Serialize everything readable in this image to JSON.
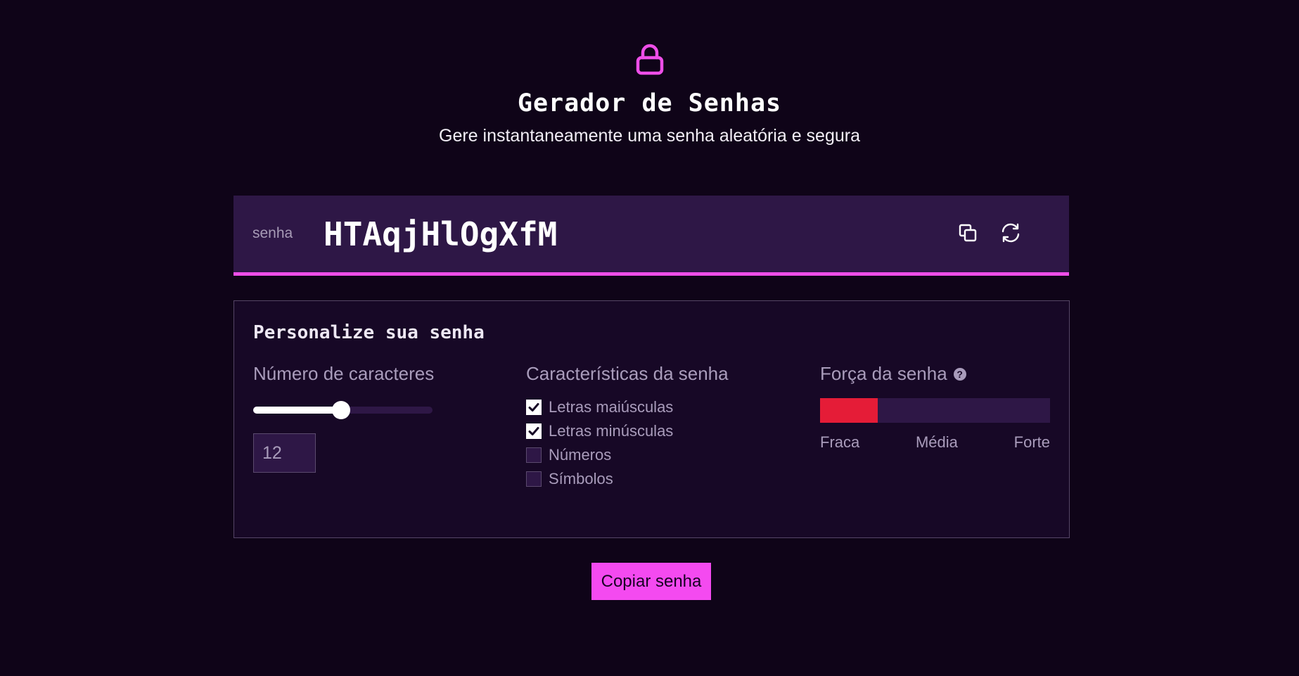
{
  "header": {
    "title": "Gerador de Senhas",
    "subtitle": "Gere instantaneamente uma senha aleatória e segura",
    "icon": "lock-icon"
  },
  "password": {
    "label": "senha",
    "value": "HTAqjHlOgXfM",
    "copy_icon": "copy-icon",
    "refresh_icon": "refresh-icon"
  },
  "customize": {
    "title": "Personalize sua senha",
    "length": {
      "title": "Número de caracteres",
      "value": "12",
      "slider_fraction": 0.49
    },
    "characteristics": {
      "title": "Características da senha",
      "options": [
        {
          "label": "Letras maiúsculas",
          "checked": true
        },
        {
          "label": "Letras minúsculas",
          "checked": true
        },
        {
          "label": "Números",
          "checked": false
        },
        {
          "label": "Símbolos",
          "checked": false
        }
      ]
    },
    "strength": {
      "title": "Força da senha",
      "help_icon": "question-circle-icon",
      "level_fraction": 0.25,
      "level_color": "#e51c37",
      "labels": [
        "Fraca",
        "Média",
        "Forte"
      ]
    }
  },
  "actions": {
    "copy_label": "Copiar senha"
  },
  "colors": {
    "background": "#0f0418",
    "accent": "#ee4ee8",
    "panel": "#2e1746"
  }
}
